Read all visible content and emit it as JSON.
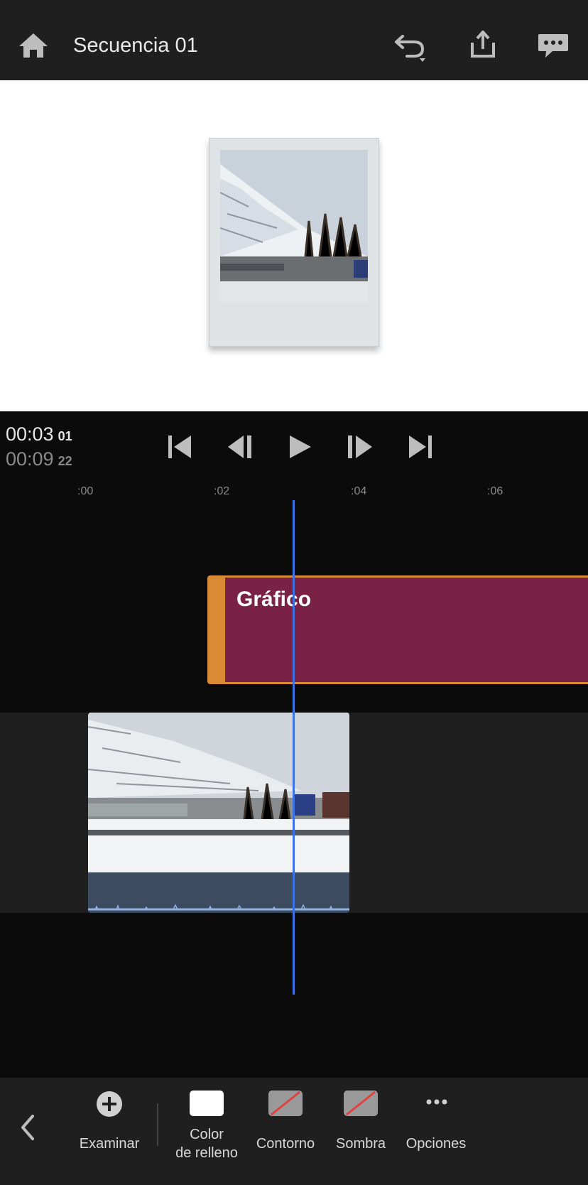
{
  "header": {
    "title": "Secuencia 01",
    "icons": [
      "home-icon",
      "undo-icon",
      "share-icon",
      "feedback-icon"
    ]
  },
  "transport": {
    "current_time": "00:03",
    "current_frames": "01",
    "total_time": "00:09",
    "total_frames": "22",
    "controls": [
      "skip-to-start-icon",
      "step-back-icon",
      "play-icon",
      "step-forward-icon",
      "skip-to-end-icon"
    ]
  },
  "ruler": {
    "ticks": [
      ":00",
      ":02",
      ":04",
      ":06"
    ]
  },
  "timeline": {
    "graphic_clip_label": "Gráfico"
  },
  "toolbar": {
    "examinar": "Examinar",
    "color_line1": "Color",
    "color_line2": "de relleno",
    "contorno": "Contorno",
    "sombra": "Sombra",
    "opciones": "Opciones"
  },
  "colors": {
    "accent_blue": "#3c72e6",
    "graphic_clip": "#7a2246",
    "graphic_border": "#d98a35",
    "fill_color": "#ffffff"
  }
}
